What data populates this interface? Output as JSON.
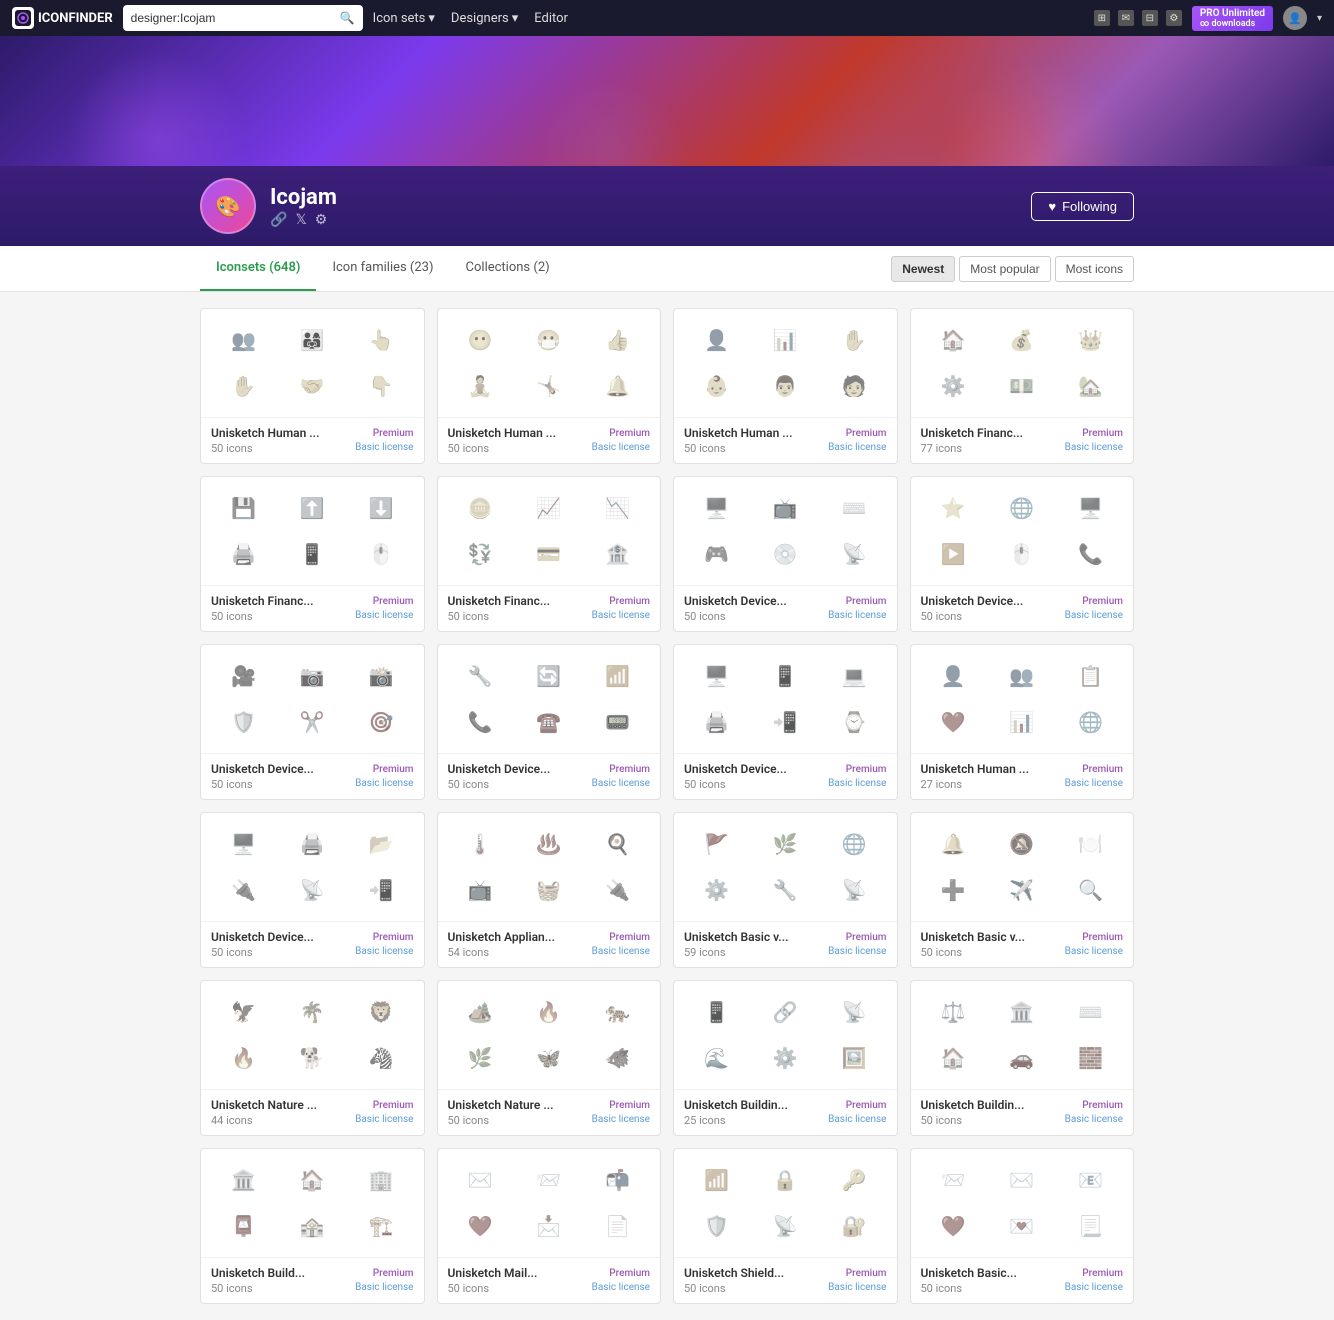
{
  "topnav": {
    "logo_text": "ICONFINDER",
    "search_placeholder": "designer:Icojam",
    "search_value": "designer:Icojam",
    "nav_items": [
      {
        "label": "Icon sets",
        "has_dropdown": true
      },
      {
        "label": "Designers",
        "has_dropdown": true
      },
      {
        "label": "Editor",
        "has_dropdown": false
      }
    ],
    "pro_label": "PRO Unlimited",
    "pro_sub": "∞ downloads"
  },
  "hero": {},
  "profile": {
    "name": "Icojam",
    "following_label": "Following",
    "heart": "♥"
  },
  "tabs": {
    "items": [
      {
        "label": "Iconsets (648)",
        "id": "iconsets",
        "active": true
      },
      {
        "label": "Icon families (23)",
        "id": "families",
        "active": false
      },
      {
        "label": "Collections (2)",
        "id": "collections",
        "active": false
      }
    ],
    "sort_options": [
      {
        "label": "Newest",
        "active": true
      },
      {
        "label": "Most popular",
        "active": false
      },
      {
        "label": "Most icons",
        "active": false
      }
    ]
  },
  "icon_cards": [
    {
      "title": "Unisketch Human ...",
      "badge": "Premium",
      "icon_count": "50 icons",
      "license": "Basic license",
      "icons": [
        "👥",
        "👨‍👩‍👧",
        "👆",
        "✋",
        "🤝",
        "👇"
      ]
    },
    {
      "title": "Unisketch Human ...",
      "badge": "Premium",
      "icon_count": "50 icons",
      "license": "Basic license",
      "icons": [
        "😶",
        "😷",
        "👍",
        "🧘",
        "🤸",
        "🔔"
      ]
    },
    {
      "title": "Unisketch Human ...",
      "badge": "Premium",
      "icon_count": "50 icons",
      "license": "Basic license",
      "icons": [
        "👤",
        "📊",
        "✋",
        "👶",
        "👨",
        "🧑"
      ]
    },
    {
      "title": "Unisketch Financ...",
      "badge": "Premium",
      "icon_count": "77 icons",
      "license": "Basic license",
      "icons": [
        "🏠",
        "💰",
        "👑",
        "⚙️",
        "💵",
        "🏡"
      ]
    },
    {
      "title": "Unisketch Financ...",
      "badge": "Premium",
      "icon_count": "50 icons",
      "license": "Basic license",
      "icons": [
        "💾",
        "⬆️",
        "⬇️",
        "🖨️",
        "📱",
        "🖱️"
      ]
    },
    {
      "title": "Unisketch Financ...",
      "badge": "Premium",
      "icon_count": "50 icons",
      "license": "Basic license",
      "icons": [
        "🪙",
        "📈",
        "📉",
        "💱",
        "💳",
        "🏦"
      ]
    },
    {
      "title": "Unisketch Device...",
      "badge": "Premium",
      "icon_count": "50 icons",
      "license": "Basic license",
      "icons": [
        "🖥️",
        "📺",
        "⌨️",
        "🎮",
        "💿",
        "📡"
      ]
    },
    {
      "title": "Unisketch Device...",
      "badge": "Premium",
      "icon_count": "50 icons",
      "license": "Basic license",
      "icons": [
        "⭐",
        "🌐",
        "🖥️",
        "▶️",
        "🖱️",
        "📞"
      ]
    },
    {
      "title": "Unisketch Device...",
      "badge": "Premium",
      "icon_count": "50 icons",
      "license": "Basic license",
      "icons": [
        "🎥",
        "📷",
        "📸",
        "🛡️",
        "✂️",
        "🎯"
      ]
    },
    {
      "title": "Unisketch Device...",
      "badge": "Premium",
      "icon_count": "50 icons",
      "license": "Basic license",
      "icons": [
        "🔧",
        "🔄",
        "📶",
        "📞",
        "☎️",
        "📟"
      ]
    },
    {
      "title": "Unisketch Device...",
      "badge": "Premium",
      "icon_count": "50 icons",
      "license": "Basic license",
      "icons": [
        "🖥️",
        "📱",
        "💻",
        "🖨️",
        "📲",
        "⌚"
      ]
    },
    {
      "title": "Unisketch Human ...",
      "badge": "Premium",
      "icon_count": "27 icons",
      "license": "Basic license",
      "icons": [
        "👤",
        "👥",
        "📋",
        "❤️",
        "📊",
        "🌐"
      ]
    },
    {
      "title": "Unisketch Device...",
      "badge": "Premium",
      "icon_count": "50 icons",
      "license": "Basic license",
      "icons": [
        "🖥️",
        "🖨️",
        "📂",
        "🔌",
        "📡",
        "📲"
      ]
    },
    {
      "title": "Unisketch Applian...",
      "badge": "Premium",
      "icon_count": "54 icons",
      "license": "Basic license",
      "icons": [
        "🌡️",
        "♨️",
        "🍳",
        "📺",
        "🧺",
        "🔌"
      ]
    },
    {
      "title": "Unisketch Basic v...",
      "badge": "Premium",
      "icon_count": "59 icons",
      "license": "Basic license",
      "icons": [
        "🚩",
        "🌿",
        "🌐",
        "⚙️",
        "🔧",
        "📡"
      ]
    },
    {
      "title": "Unisketch Basic v...",
      "badge": "Premium",
      "icon_count": "50 icons",
      "license": "Basic license",
      "icons": [
        "🔔",
        "🔕",
        "🍽️",
        "➕",
        "✈️",
        "🔍"
      ]
    },
    {
      "title": "Unisketch Nature ...",
      "badge": "Premium",
      "icon_count": "44 icons",
      "license": "Basic license",
      "icons": [
        "🦅",
        "🌴",
        "🦁",
        "🔥",
        "🐕",
        "🦓"
      ]
    },
    {
      "title": "Unisketch Nature ...",
      "badge": "Premium",
      "icon_count": "50 icons",
      "license": "Basic license",
      "icons": [
        "🏕️",
        "🔥",
        "🐅",
        "🌿",
        "🦋",
        "🐗"
      ]
    },
    {
      "title": "Unisketch Buildin...",
      "badge": "Premium",
      "icon_count": "25 icons",
      "license": "Basic license",
      "icons": [
        "📱",
        "🔗",
        "📡",
        "🌊",
        "⚙️",
        "🖼️"
      ]
    },
    {
      "title": "Unisketch Buildin...",
      "badge": "Premium",
      "icon_count": "50 icons",
      "license": "Basic license",
      "icons": [
        "⚖️",
        "🏛️",
        "⌨️",
        "🏠",
        "🚗",
        "🧱"
      ]
    },
    {
      "title": "Unisketch Build...",
      "badge": "Premium",
      "icon_count": "50 icons",
      "license": "Basic license",
      "icons": [
        "🏛️",
        "🏠",
        "🏢",
        "📮",
        "🏤",
        "🏗️"
      ]
    },
    {
      "title": "Unisketch Mail...",
      "badge": "Premium",
      "icon_count": "50 icons",
      "license": "Basic license",
      "icons": [
        "✉️",
        "📨",
        "📬",
        "❤️",
        "📩",
        "📄"
      ]
    },
    {
      "title": "Unisketch Shield...",
      "badge": "Premium",
      "icon_count": "50 icons",
      "license": "Basic license",
      "icons": [
        "📶",
        "🔒",
        "🔑",
        "🛡️",
        "📡",
        "🔐"
      ]
    },
    {
      "title": "Unisketch Basic...",
      "badge": "Premium",
      "icon_count": "50 icons",
      "license": "Basic license",
      "icons": [
        "📨",
        "✉️",
        "📧",
        "❤️",
        "💌",
        "📃"
      ]
    }
  ]
}
